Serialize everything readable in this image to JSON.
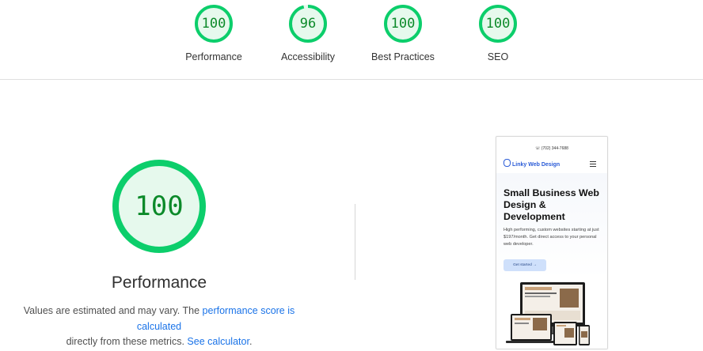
{
  "top_gauges": [
    {
      "score": "100",
      "label": "Performance",
      "fraction": 1.0
    },
    {
      "score": "96",
      "label": "Accessibility",
      "fraction": 0.96
    },
    {
      "score": "100",
      "label": "Best Practices",
      "fraction": 1.0
    },
    {
      "score": "100",
      "label": "SEO",
      "fraction": 1.0
    }
  ],
  "main": {
    "score": "100",
    "fraction": 1.0,
    "title": "Performance",
    "desc_prefix": "Values are estimated and may vary. The ",
    "score_link": "performance score is calculated",
    "desc_mid": "directly from these metrics. ",
    "calc_link": "See calculator",
    "desc_suffix": "."
  },
  "screenshot": {
    "phone": "(702) 344-7688",
    "brand": "Linky Web Design",
    "headline": "Small Business Web Design & Development",
    "subtext": "High performing, custom websites starting at just $197/month. Get direct access to your personal web developer.",
    "cta": "Get started →"
  },
  "colors": {
    "pass_stroke": "#0cce6b",
    "pass_fill": "#e6f9ed",
    "pass_text": "#0c8a2a",
    "link": "#1a73e8"
  }
}
